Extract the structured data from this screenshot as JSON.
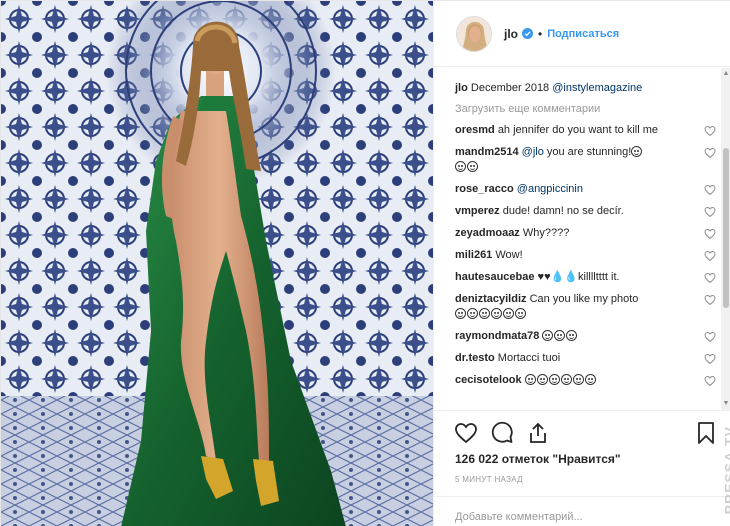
{
  "header": {
    "username": "jlo",
    "dot": "•",
    "follow_label": "Подписаться"
  },
  "caption": {
    "username": "jlo",
    "text": "December 2018",
    "mention": "@instylemagazine"
  },
  "load_more_label": "Загрузить еще комментарии",
  "comments": [
    {
      "user": "oresmd",
      "text": "ah jennifer do you want to kill me"
    },
    {
      "user": "mandm2514",
      "mention": "@jlo",
      "text": "you are stunning!",
      "emoji_after": 1,
      "emoji_line2": 2
    },
    {
      "user": "rose_racco",
      "mention": "@angpiccinin",
      "text": ""
    },
    {
      "user": "vmperez",
      "text": "dude! damn! no se decír."
    },
    {
      "user": "zeyadmoaaz",
      "text": "Why????"
    },
    {
      "user": "mili261",
      "text": "Wow!"
    },
    {
      "user": "hautesaucebae",
      "text": "♥♥💧💧killlltttt it."
    },
    {
      "user": "deniztacyildiz",
      "text": "Can you like my photo",
      "emoji_line2": 6
    },
    {
      "user": "raymondmata78",
      "text": "",
      "emoji_after": 3
    },
    {
      "user": "dr.testo",
      "text": "Mortacci tuoi"
    },
    {
      "user": "cecisotelook",
      "text": "",
      "emoji_after": 6
    }
  ],
  "likes_text": "126 022 отметок \"Нравится\"",
  "time_text": "5 МИНУТ НАЗАД",
  "add_comment_placeholder": "Добавьте комментарий...",
  "watermark": "PRESSA.TV",
  "colors": {
    "link_blue": "#3897f0",
    "mention_blue": "#003569",
    "dress_green": "#1f7a3a",
    "tile_blue": "#2c3f7a"
  }
}
